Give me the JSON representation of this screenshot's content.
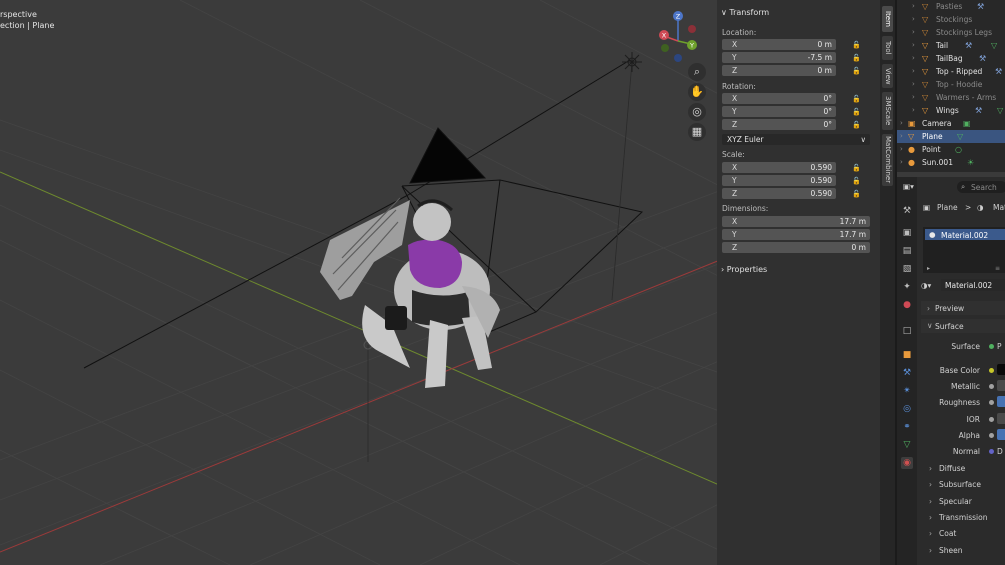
{
  "viewport": {
    "title_line1": "rspective",
    "title_line2": "ection | Plane"
  },
  "nav_icons": [
    "zoom-icon",
    "pan-hand-icon",
    "camera-view-icon",
    "ortho-grid-icon"
  ],
  "gizmo": {
    "z": "Z",
    "x": "X",
    "y": "Y"
  },
  "npanel": {
    "transform_title": "Transform",
    "location_label": "Location:",
    "location": [
      {
        "axis": "X",
        "value": "0 m"
      },
      {
        "axis": "Y",
        "value": "-7.5 m"
      },
      {
        "axis": "Z",
        "value": "0 m"
      }
    ],
    "rotation_label": "Rotation:",
    "rotation": [
      {
        "axis": "X",
        "value": "0°"
      },
      {
        "axis": "Y",
        "value": "0°"
      },
      {
        "axis": "Z",
        "value": "0°"
      }
    ],
    "rotation_mode": "XYZ Euler",
    "scale_label": "Scale:",
    "scale": [
      {
        "axis": "X",
        "value": "0.590"
      },
      {
        "axis": "Y",
        "value": "0.590"
      },
      {
        "axis": "Z",
        "value": "0.590"
      }
    ],
    "dimensions_label": "Dimensions:",
    "dimensions": [
      {
        "axis": "X",
        "value": "17.7 m"
      },
      {
        "axis": "Y",
        "value": "17.7 m"
      },
      {
        "axis": "Z",
        "value": "0 m"
      }
    ],
    "properties_title": "Properties"
  },
  "vtabs": [
    "Item",
    "Tool",
    "View",
    "3MScale",
    "MatCombiner"
  ],
  "outliner": [
    {
      "name": "Pasties",
      "dim": true
    },
    {
      "name": "Stockings",
      "dim": true
    },
    {
      "name": "Stockings Legs",
      "dim": true
    },
    {
      "name": "Tail",
      "dim": false
    },
    {
      "name": "TailBag",
      "dim": false
    },
    {
      "name": "Top - Ripped",
      "dim": false
    },
    {
      "name": "Top - Hoodie",
      "dim": true
    },
    {
      "name": "Warmers - Arms",
      "dim": true
    },
    {
      "name": "Wings",
      "dim": false
    },
    {
      "name": "Camera",
      "dim": false
    },
    {
      "name": "Plane",
      "dim": false
    },
    {
      "name": "Point",
      "dim": false
    },
    {
      "name": "Sun.001",
      "dim": false
    }
  ],
  "properties": {
    "search_placeholder": "Search",
    "breadcrumb_object": "Plane",
    "breadcrumb_sep": ">",
    "breadcrumb_material": "Mat",
    "slot": "Material.002",
    "material_name": "Material.002",
    "preview": "Preview",
    "surface": "Surface",
    "surface_label": "Surface",
    "surface_value": "P",
    "inputs": [
      {
        "label": "Base Color",
        "dot": "#c7c729",
        "swatch": "#0a0a0a"
      },
      {
        "label": "Metallic",
        "dot": "#a1a1a1",
        "swatch": "#4a4a4a"
      },
      {
        "label": "Roughness",
        "dot": "#a1a1a1",
        "swatch": "#4772b3"
      },
      {
        "label": "IOR",
        "dot": "#a1a1a1",
        "swatch": "#4a4a4a"
      },
      {
        "label": "Alpha",
        "dot": "#a1a1a1",
        "swatch": "#4772b3"
      },
      {
        "label": "Normal",
        "dot": "#6363c7",
        "swatch": "#555555"
      }
    ],
    "normal_value": "D",
    "panels": [
      "Diffuse",
      "Subsurface",
      "Specular",
      "Transmission",
      "Coat",
      "Sheen"
    ]
  }
}
